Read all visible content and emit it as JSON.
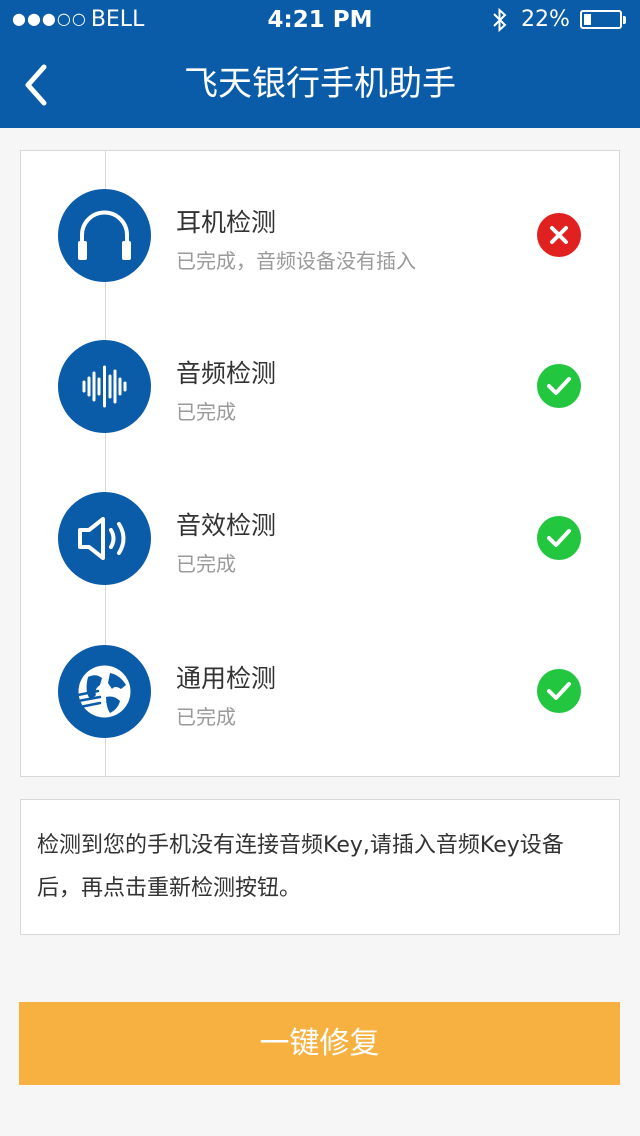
{
  "status_bar": {
    "signal_dots": "●●●○○",
    "carrier": "BELL",
    "time": "4:21 PM",
    "battery_percent": "22%",
    "battery_level": 0.22
  },
  "nav": {
    "title": "飞天银行手机助手",
    "back_icon": "chevron-left-icon"
  },
  "checks": [
    {
      "title": "耳机检测",
      "subtitle": "已完成，音频设备没有插入",
      "icon": "headphones-icon",
      "status": "fail",
      "status_icon": "cross-icon",
      "status_color": "#e1211f"
    },
    {
      "title": "音频检测",
      "subtitle": "已完成",
      "icon": "audio-waveform-icon",
      "status": "ok",
      "status_icon": "check-icon",
      "status_color": "#22c63f"
    },
    {
      "title": "音效检测",
      "subtitle": "已完成",
      "icon": "speaker-icon",
      "status": "ok",
      "status_icon": "check-icon",
      "status_color": "#22c63f"
    },
    {
      "title": "通用检测",
      "subtitle": "已完成",
      "icon": "globe-icon",
      "status": "ok",
      "status_icon": "check-icon",
      "status_color": "#22c63f"
    }
  ],
  "message": "检测到您的手机没有连接音频Key,请插入音频Key设备后，再点击重新检测按钮。",
  "fix_button_label": "一键修复",
  "colors": {
    "header": "#0a5ba8",
    "button": "#f7b141",
    "ok": "#22c63f",
    "fail": "#e1211f"
  }
}
